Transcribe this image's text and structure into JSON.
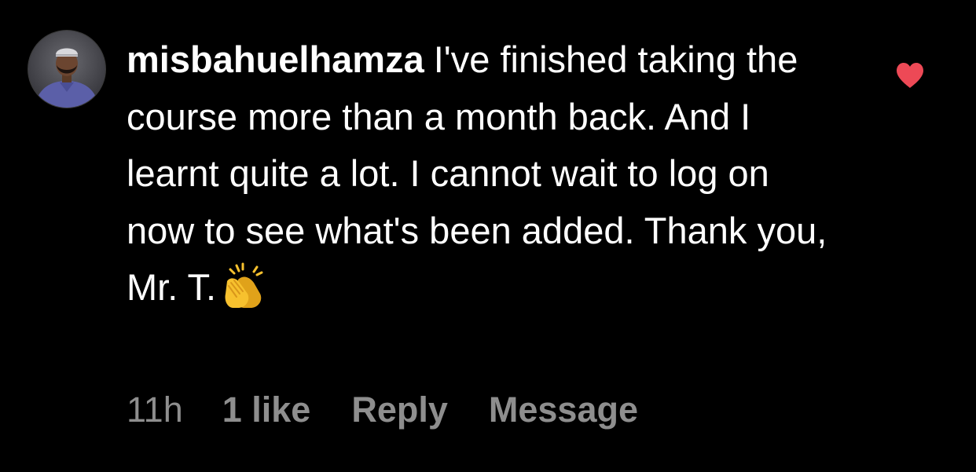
{
  "comment": {
    "username": "misbahuelhamza",
    "text": "I've finished taking the course more than a month back. And I learnt quite a lot. I cannot wait to log on now to see what's been added. Thank you, Mr. T.",
    "emoji": "clapping-hands-emoji",
    "time": "11h",
    "likes": "1 like",
    "reply_label": "Reply",
    "message_label": "Message",
    "liked": true
  },
  "icons": {
    "heart": "heart-icon",
    "avatar": "avatar"
  },
  "colors": {
    "background": "#000000",
    "text": "#ffffff",
    "meta": "#8e8e8e",
    "heart": "#ed4956",
    "emoji": "#f7c12e"
  }
}
